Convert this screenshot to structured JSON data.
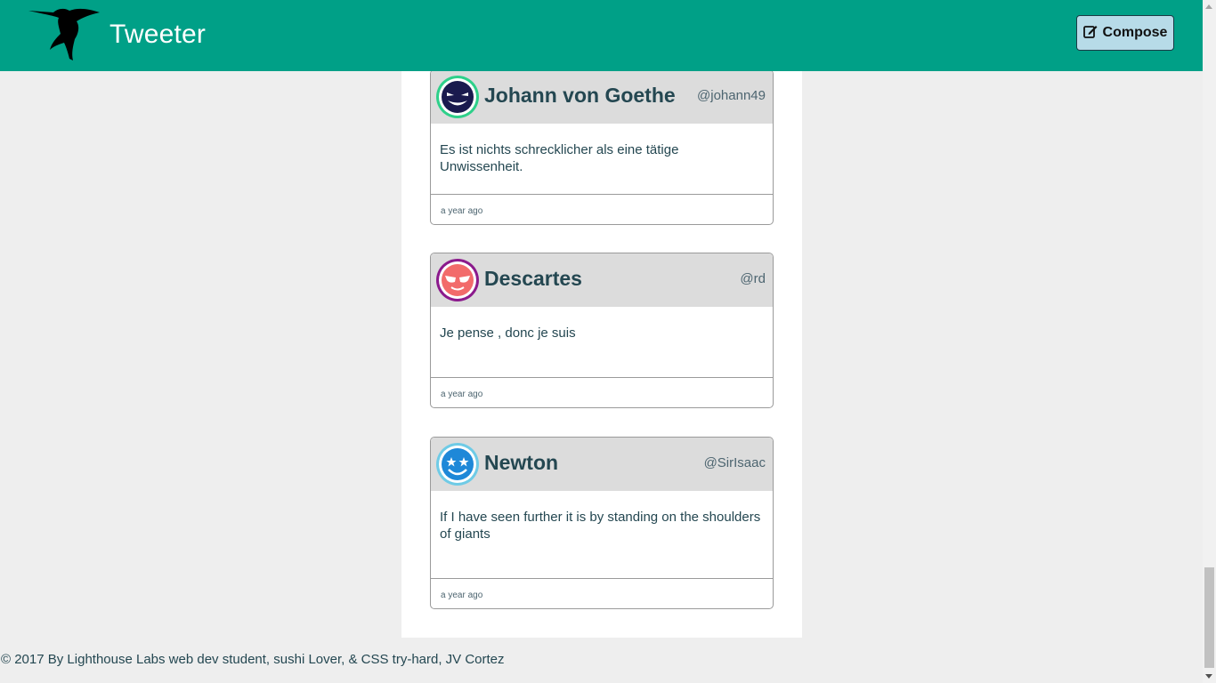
{
  "header": {
    "brand": "Tweeter",
    "logo_icon": "hummingbird-icon",
    "compose_label": "Compose",
    "compose_icon": "pencil-square-icon",
    "colors": {
      "nav_bg": "#00a087",
      "compose_bg": "#b7dbe8"
    }
  },
  "tweets": [
    {
      "name": "Johann von Goethe",
      "handle": "@johann49",
      "content": "Es ist nichts schrecklicher als eine tätige Unwissenheit.",
      "time": "a year ago",
      "avatar": {
        "icon": "grinning-devil-face-icon",
        "ring_color": "#2ed08a",
        "face_color": "#1a1a4e"
      }
    },
    {
      "name": "Descartes",
      "handle": "@rd",
      "content": "Je pense , donc je suis",
      "time": "a year ago",
      "avatar": {
        "icon": "sunglasses-face-icon",
        "ring_color": "#8b1a8c",
        "face_color": "#f26b6b"
      }
    },
    {
      "name": "Newton",
      "handle": "@SirIsaac",
      "content": "If I have seen further it is by standing on the shoulders of giants",
      "time": "a year ago",
      "avatar": {
        "icon": "star-eyes-face-icon",
        "ring_color": "#6fcbe6",
        "face_color": "#1e88d8"
      }
    }
  ],
  "footer": {
    "text": "© 2017 By Lighthouse Labs web dev student, sushi Lover, & CSS try-hard, JV Cortez"
  }
}
